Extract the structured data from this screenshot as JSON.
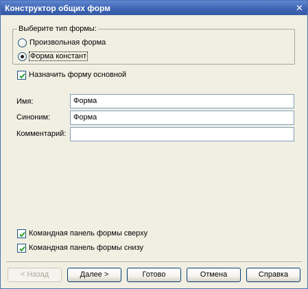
{
  "window": {
    "title": "Конструктор общих форм",
    "close_glyph": "✕"
  },
  "form_type": {
    "legend": "Выберите тип формы:",
    "options": [
      {
        "label": "Произвольная форма",
        "selected": false
      },
      {
        "label": "Форма констант",
        "selected": true
      }
    ]
  },
  "main_form_checkbox": {
    "label": "Назначить форму основной",
    "checked": true
  },
  "fields": {
    "name": {
      "label": "Имя:",
      "value": "Форма"
    },
    "synonym": {
      "label": "Синоним:",
      "value": "Форма"
    },
    "comment": {
      "label": "Комментарий:",
      "value": ""
    }
  },
  "panels": {
    "top": {
      "label": "Командная панель формы сверху",
      "checked": true
    },
    "bottom": {
      "label": "Командная панель формы снизу",
      "checked": true
    }
  },
  "buttons": {
    "back": "< Назад",
    "next": "Далее >",
    "done": "Готово",
    "cancel": "Отмена",
    "help": "Справка"
  },
  "colors": {
    "titlebar": "#3e64b3",
    "dialog_bg": "#f1efe2",
    "field_border": "#7f9db9"
  }
}
